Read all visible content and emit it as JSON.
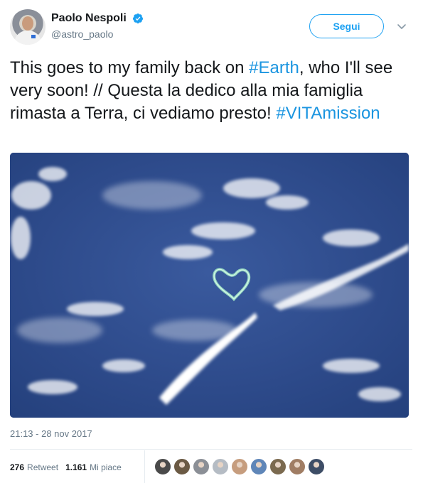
{
  "author": {
    "name": "Paolo Nespoli",
    "handle": "@astro_paolo",
    "verified_icon": "verified-badge-icon"
  },
  "follow_button": {
    "label": "Segui"
  },
  "tweet": {
    "segments": [
      {
        "text": "This goes to my family back on ",
        "hashtag": false
      },
      {
        "text": "#Earth",
        "hashtag": true
      },
      {
        "text": ", who I'll see very soon! // Questa la dedico alla mia famiglia rimasta a Terra, ci vediamo presto! ",
        "hashtag": false
      },
      {
        "text": "#VITAmission",
        "hashtag": true
      }
    ],
    "timestamp": "21:13 - 28 nov 2017"
  },
  "stats": {
    "retweets_count": "276",
    "retweets_label": "Retweet",
    "likes_count": "1.161",
    "likes_label": "Mi piace"
  },
  "likers": [
    {
      "color": "#4a4a4a"
    },
    {
      "color": "#6b5a44"
    },
    {
      "color": "#8b8f96"
    },
    {
      "color": "#b5bcc4"
    },
    {
      "color": "#c69d7e"
    },
    {
      "color": "#5f86b8"
    },
    {
      "color": "#7b6a4f"
    },
    {
      "color": "#a07d64"
    },
    {
      "color": "#3d4d66"
    }
  ],
  "colors": {
    "accent": "#1da1f2",
    "hashtag": "#1b95e0",
    "secondary_text": "#657786"
  }
}
